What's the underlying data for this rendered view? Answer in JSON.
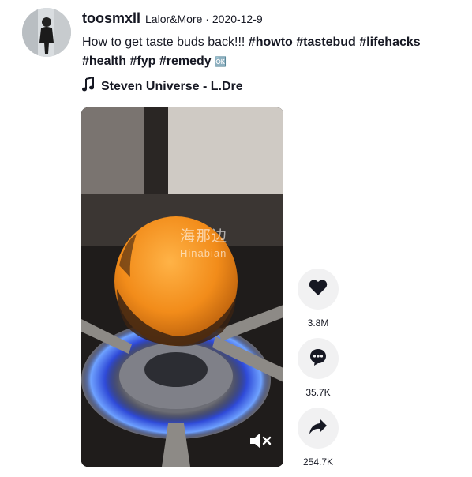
{
  "author": {
    "username": "toosmxll",
    "nickname": "Lalor&More",
    "date": "2020-12-9"
  },
  "caption": {
    "text": "How to get taste buds back!!!",
    "tags": [
      "#howto",
      "#tastebud",
      "#lifehacks",
      "#health",
      "#fyp",
      "#remedy"
    ],
    "tail_glyph": "🆗"
  },
  "music": {
    "icon": "music-note-icon",
    "title": "Steven Universe - L.Dre"
  },
  "video": {
    "watermark_cn": "海那边",
    "watermark_en": "Hinabian"
  },
  "actions": {
    "likes": "3.8M",
    "comments": "35.7K",
    "shares": "254.7K"
  },
  "colors": {
    "text": "#161823",
    "action_bg": "#f1f1f2",
    "orange": "#f28c1a"
  }
}
